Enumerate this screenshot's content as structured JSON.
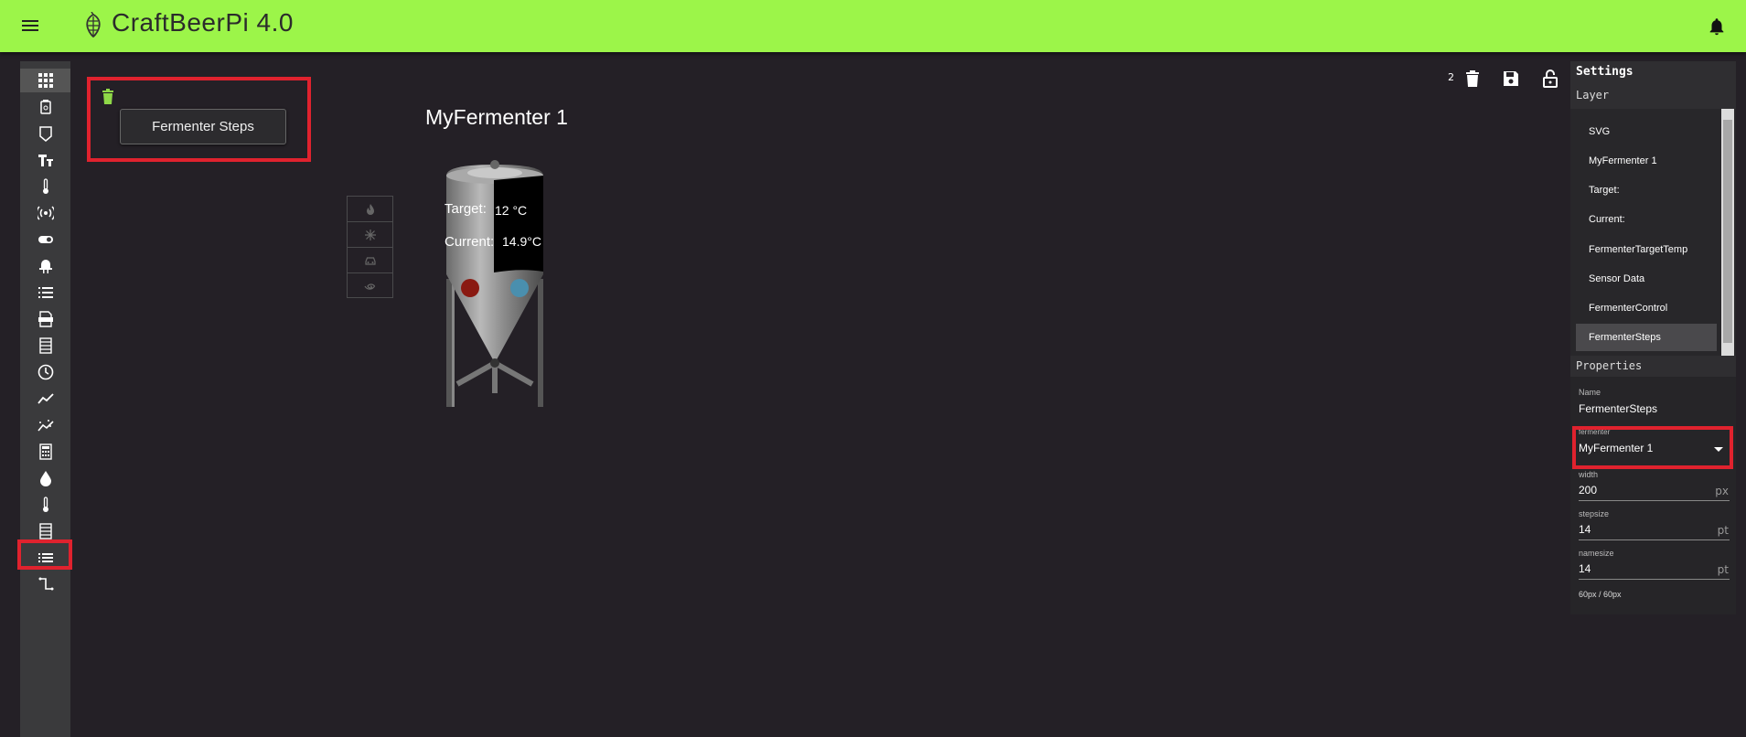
{
  "header": {
    "title": "CraftBeerPi 4.0"
  },
  "sidebar": {
    "icons": [
      "grid-icon",
      "kettle-icon",
      "tag-icon",
      "text-icon",
      "thermometer-icon",
      "sensor-wave-icon",
      "toggle-icon",
      "led-icon",
      "list-icon",
      "svg-file-icon",
      "table-icon",
      "clock-icon",
      "chart-line-icon",
      "chart-scatter-icon",
      "calculator-icon",
      "drop-icon",
      "thermometer-icon",
      "table-icon",
      "steps-list-icon",
      "path-icon"
    ]
  },
  "toolbar": {
    "count": "2"
  },
  "canvas": {
    "steps_button": "Fermenter Steps",
    "fermenter_name": "MyFermenter 1",
    "target_label": "Target:",
    "target_value": "12 °C",
    "current_label": "Current:",
    "current_value": "14.9°C"
  },
  "settings": {
    "title": "Settings",
    "layer_title": "Layer",
    "layers": [
      "SVG",
      "MyFermenter 1",
      "Target:",
      "Current:",
      "FermenterTargetTemp",
      "Sensor Data",
      "FermenterControl",
      "FermenterSteps"
    ],
    "properties_title": "Properties",
    "name_label": "Name",
    "name_value": "FermenterSteps",
    "fermenter_label": "fermenter",
    "fermenter_value": "MyFermenter 1",
    "width_label": "width",
    "width_value": "200",
    "width_unit": "px",
    "stepsize_label": "stepsize",
    "stepsize_value": "14",
    "stepsize_unit": "pt",
    "namesize_label": "namesize",
    "namesize_value": "14",
    "namesize_unit": "pt",
    "footer": "60px / 60px"
  },
  "colors": {
    "accent": "#9cf549",
    "highlight": "#e0222e",
    "background": "#242026"
  }
}
